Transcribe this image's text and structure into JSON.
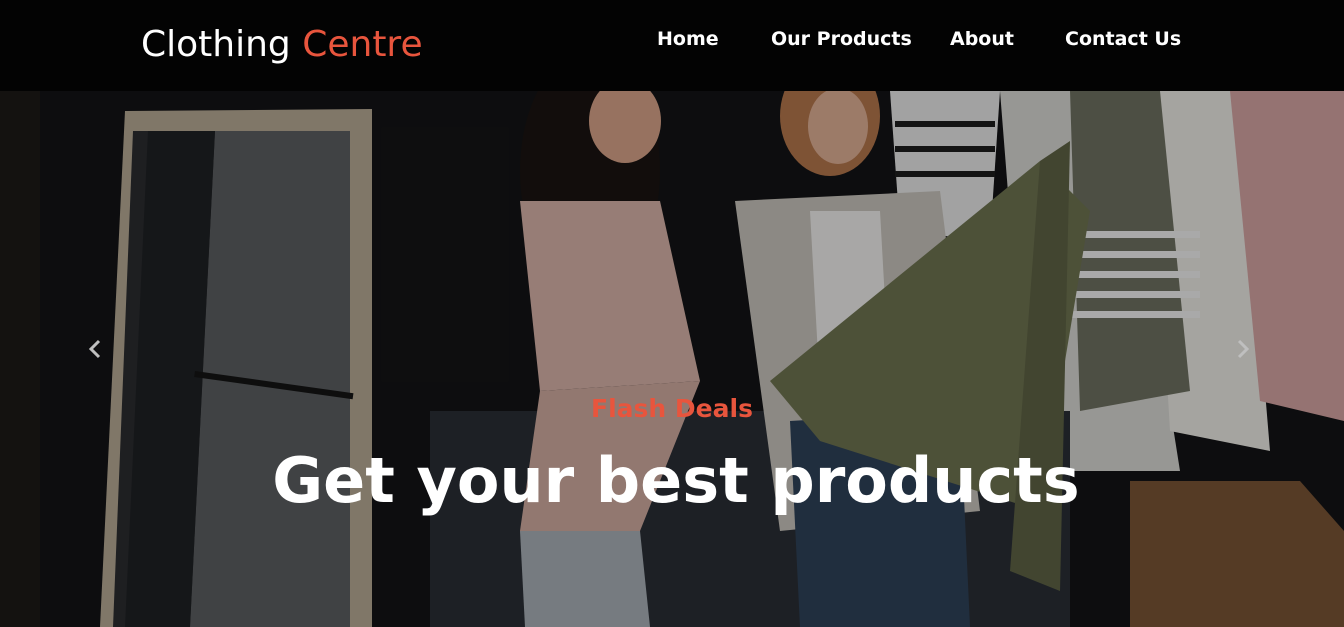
{
  "brand": {
    "part1": "Clothing",
    "part2": "Centre"
  },
  "nav": {
    "home": "Home",
    "products": "Our Products",
    "about": "About",
    "contact": "Contact Us"
  },
  "hero": {
    "subtitle": "Flash Deals",
    "title": "Get your best products",
    "prev_icon": "chevron-left-icon",
    "next_icon": "chevron-right-icon"
  },
  "colors": {
    "accent": "#e8553d",
    "navbar_bg": "#030303",
    "text": "#ffffff"
  }
}
